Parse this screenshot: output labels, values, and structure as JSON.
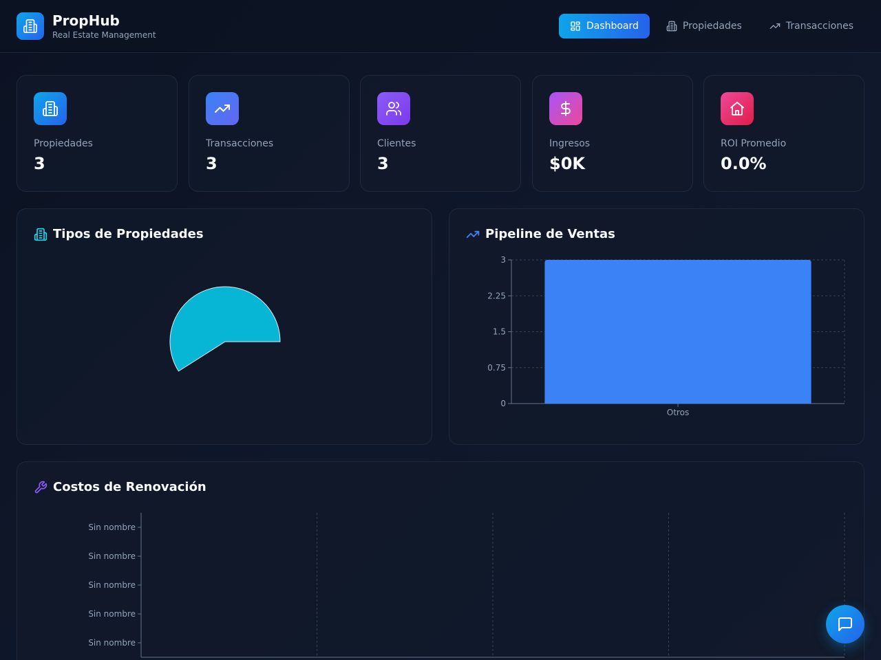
{
  "app": {
    "title": "PropHub",
    "subtitle": "Real Estate Management"
  },
  "nav": {
    "items": [
      {
        "label": "Dashboard",
        "icon": "layout-grid-icon",
        "active": true
      },
      {
        "label": "Propiedades",
        "icon": "building-icon",
        "active": false
      },
      {
        "label": "Transacciones",
        "icon": "trending-up-icon",
        "active": false
      }
    ]
  },
  "stats": [
    {
      "label": "Propiedades",
      "value": "3",
      "icon": "building-icon",
      "color_from": "#0ea5e9",
      "color_to": "#2563eb"
    },
    {
      "label": "Transacciones",
      "value": "3",
      "icon": "trending-up-icon",
      "color_from": "#3b82f6",
      "color_to": "#6366f1"
    },
    {
      "label": "Clientes",
      "value": "3",
      "icon": "users-icon",
      "color_from": "#8b5cf6",
      "color_to": "#7c3aed"
    },
    {
      "label": "Ingresos",
      "value": "$0K",
      "icon": "dollar-icon",
      "color_from": "#a855f7",
      "color_to": "#ec4899"
    },
    {
      "label": "ROI Promedio",
      "value": "0.0%",
      "icon": "home-icon",
      "color_from": "#ec4899",
      "color_to": "#e11d48"
    }
  ],
  "panels": {
    "property_types": {
      "title": "Tipos de Propiedades",
      "icon": "building-icon",
      "icon_color": "#22d3ee"
    },
    "sales_pipeline": {
      "title": "Pipeline de Ventas",
      "icon": "trending-up-icon",
      "icon_color": "#3b82f6"
    },
    "renovation_costs": {
      "title": "Costos de Renovación",
      "icon": "wrench-icon",
      "icon_color": "#8b5cf6"
    }
  },
  "chart_data": [
    {
      "type": "pie",
      "categories": [],
      "values": [],
      "colors": [
        "#06b6d4"
      ],
      "note_visible_slice_fraction": 0.59
    },
    {
      "type": "bar",
      "categories": [
        "Otros"
      ],
      "series": [
        {
          "values": [
            3
          ]
        }
      ],
      "ylim": [
        0,
        3
      ],
      "yticks": [
        "0",
        "0.75",
        "1.5",
        "2.25",
        "3"
      ],
      "grid": true,
      "color": "#3b82f6"
    },
    {
      "type": "bar",
      "orientation": "horizontal",
      "categories": [
        "Sin nombre",
        "Sin nombre",
        "Sin nombre",
        "Sin nombre",
        "Sin nombre"
      ],
      "series": [
        {
          "values": [
            0,
            0,
            0,
            0,
            0
          ]
        }
      ],
      "grid": true
    }
  ],
  "fab": {
    "icon": "chat-icon"
  }
}
